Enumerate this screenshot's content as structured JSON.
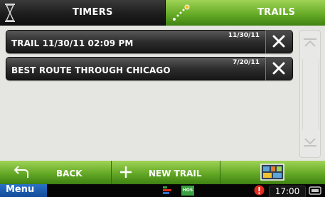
{
  "tabs": {
    "timers": {
      "label": "TIMERS",
      "icon": "hourglass-icon",
      "active": false
    },
    "trails": {
      "label": "TRAILS",
      "icon": "trail-path-icon",
      "active": true
    }
  },
  "trails": [
    {
      "name": "TRAIL 11/30/11 02:09 PM",
      "date": "11/30/11",
      "delete_icon": "close-icon"
    },
    {
      "name": "BEST ROUTE THROUGH CHICAGO",
      "date": "7/20/11",
      "delete_icon": "close-icon"
    }
  ],
  "scrollbar": {
    "up_icon": "chevron-up-icon",
    "down_icon": "chevron-down-icon"
  },
  "actions": {
    "back_label": "BACK",
    "back_icon": "back-arrow-icon",
    "new_trail_label": "NEW TRAIL",
    "new_trail_icon": "plus-icon",
    "map_icon": "map-icon"
  },
  "status": {
    "menu_label": "Menu",
    "hos_label": "HOS",
    "time": "17:00",
    "alert_icon": "alert-icon",
    "device_icon": "device-icon"
  },
  "colors": {
    "accent_green": "#66ab26",
    "dark_row": "#2d2d2d",
    "menu_blue": "#1a5cb0",
    "alert_red": "#e22b1f"
  }
}
